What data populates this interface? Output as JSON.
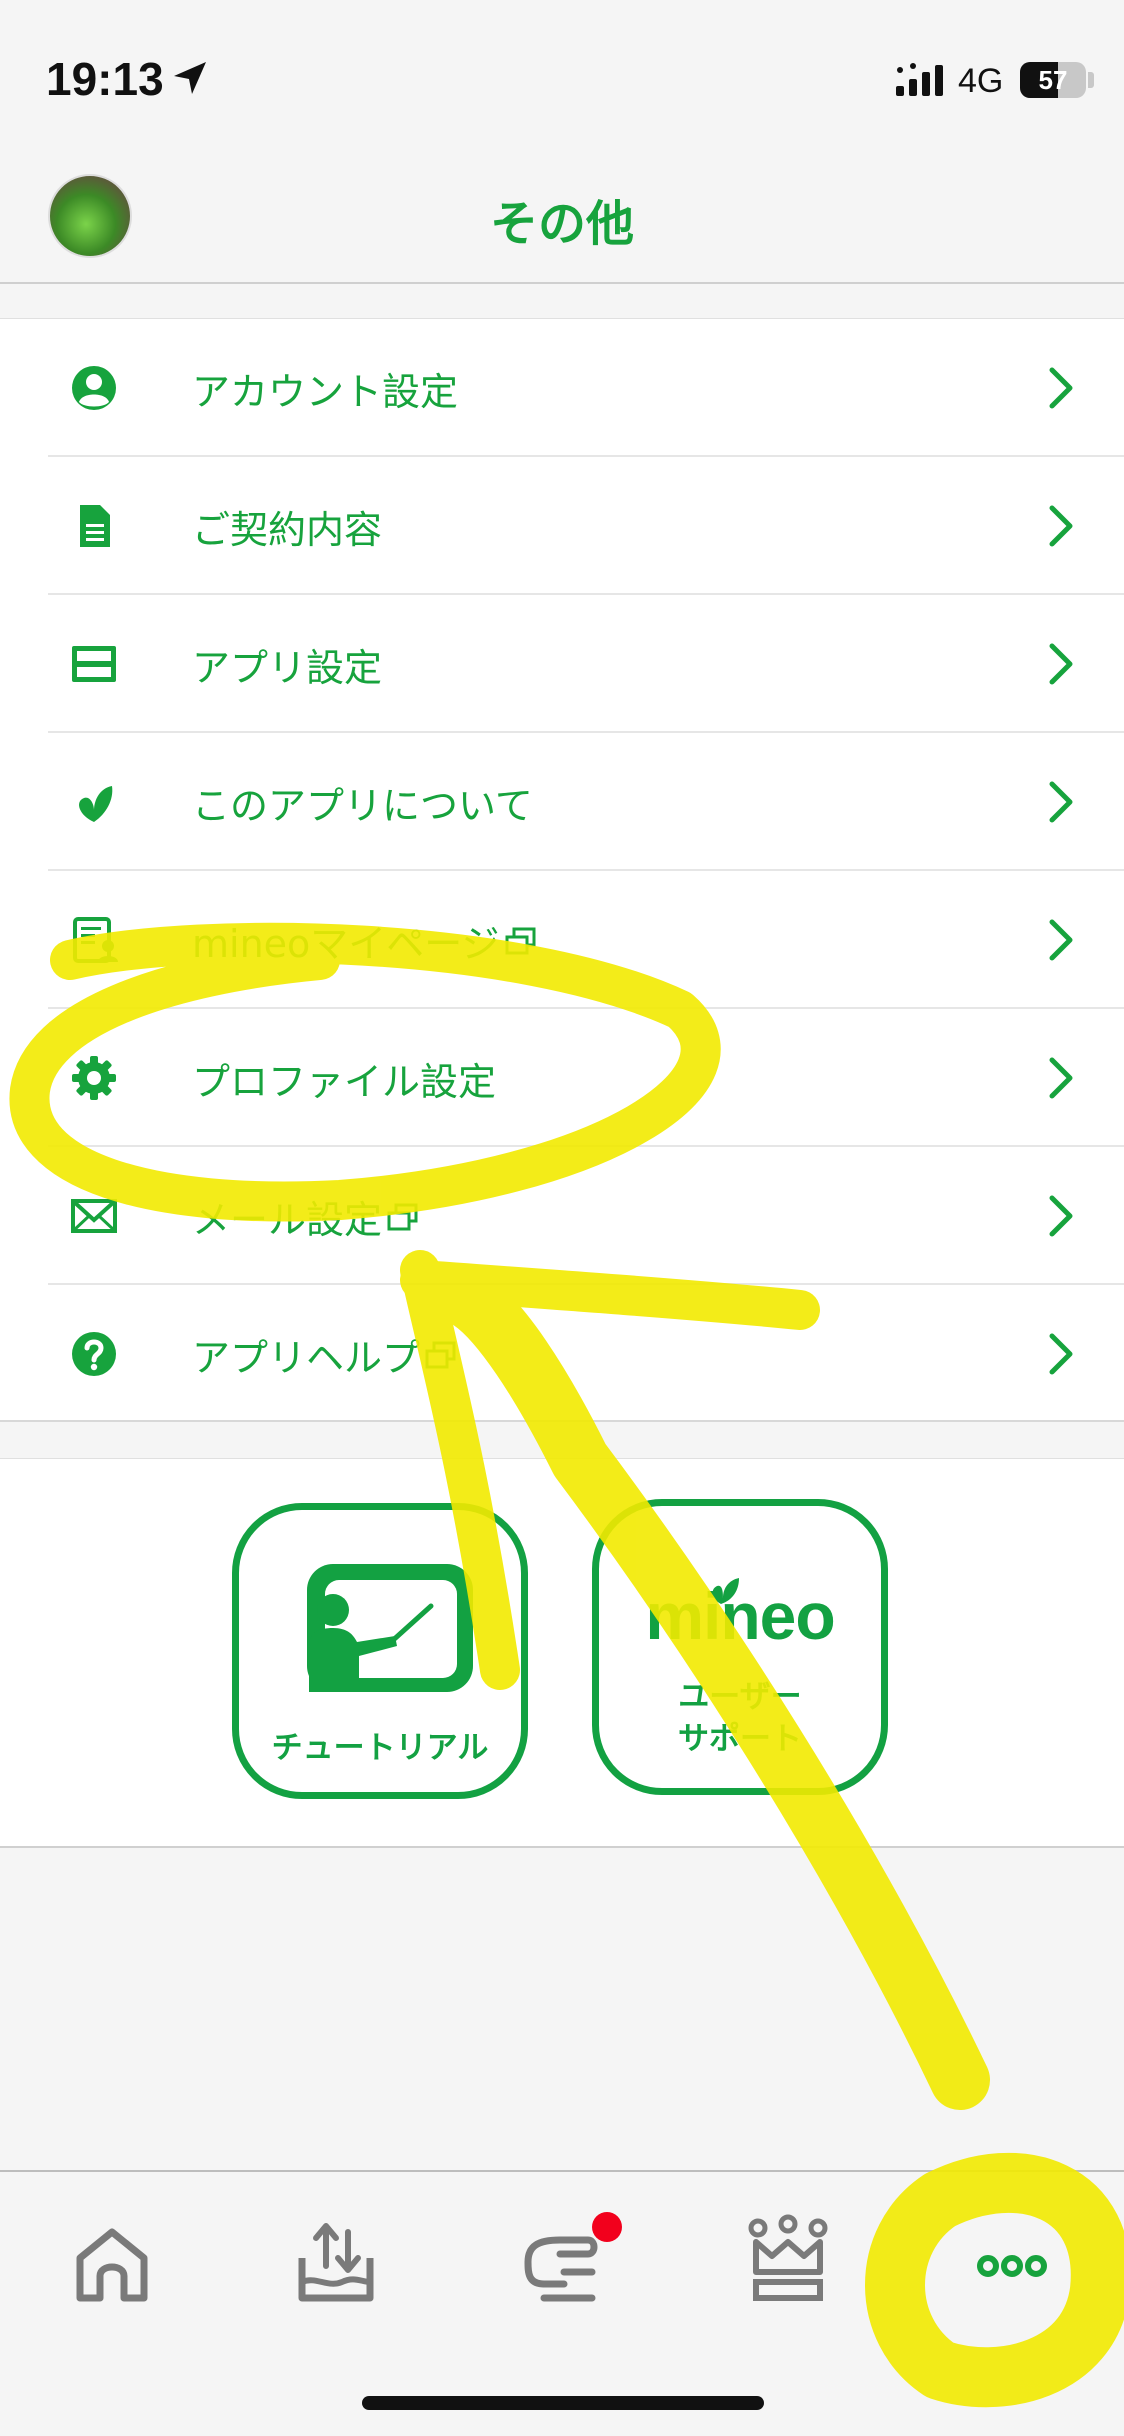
{
  "status_bar": {
    "time": "19:13",
    "network": "4G",
    "battery": "57",
    "battery_level_percent": 57,
    "icons": [
      "location-arrow-icon",
      "signal-icon",
      "battery-icon"
    ]
  },
  "header": {
    "title": "その他",
    "avatar": "user-avatar"
  },
  "menu": {
    "items": [
      {
        "label": "アカウント設定",
        "icon": "account-icon",
        "external": false
      },
      {
        "label": "ご契約内容",
        "icon": "document-icon",
        "external": false
      },
      {
        "label": "アプリ設定",
        "icon": "app-settings-icon",
        "external": false
      },
      {
        "label": "このアプリについて",
        "icon": "mineo-leaf-icon",
        "external": false
      },
      {
        "label": "mineoマイページ",
        "icon": "mypage-icon",
        "external": true
      },
      {
        "label": "プロファイル設定",
        "icon": "gear-icon",
        "external": false
      },
      {
        "label": "メール設定",
        "icon": "mail-icon",
        "external": true
      },
      {
        "label": "アプリヘルプ",
        "icon": "help-icon",
        "external": true
      }
    ]
  },
  "shortcuts": {
    "tutorial_label": "チュートリアル",
    "support_logo": "mineo",
    "support_line1": "ユーザー",
    "support_line2": "サポート"
  },
  "tabbar": {
    "tabs": [
      {
        "icon": "home-icon"
      },
      {
        "icon": "data-share-icon"
      },
      {
        "icon": "chat-icon",
        "badge": true
      },
      {
        "icon": "crown-icon"
      },
      {
        "icon": "more-dots-icon",
        "active": true
      }
    ]
  },
  "colors": {
    "brand_green": "#17a33d",
    "badge_red": "#f2001c",
    "highlight_yellow": "#f2ea00"
  }
}
